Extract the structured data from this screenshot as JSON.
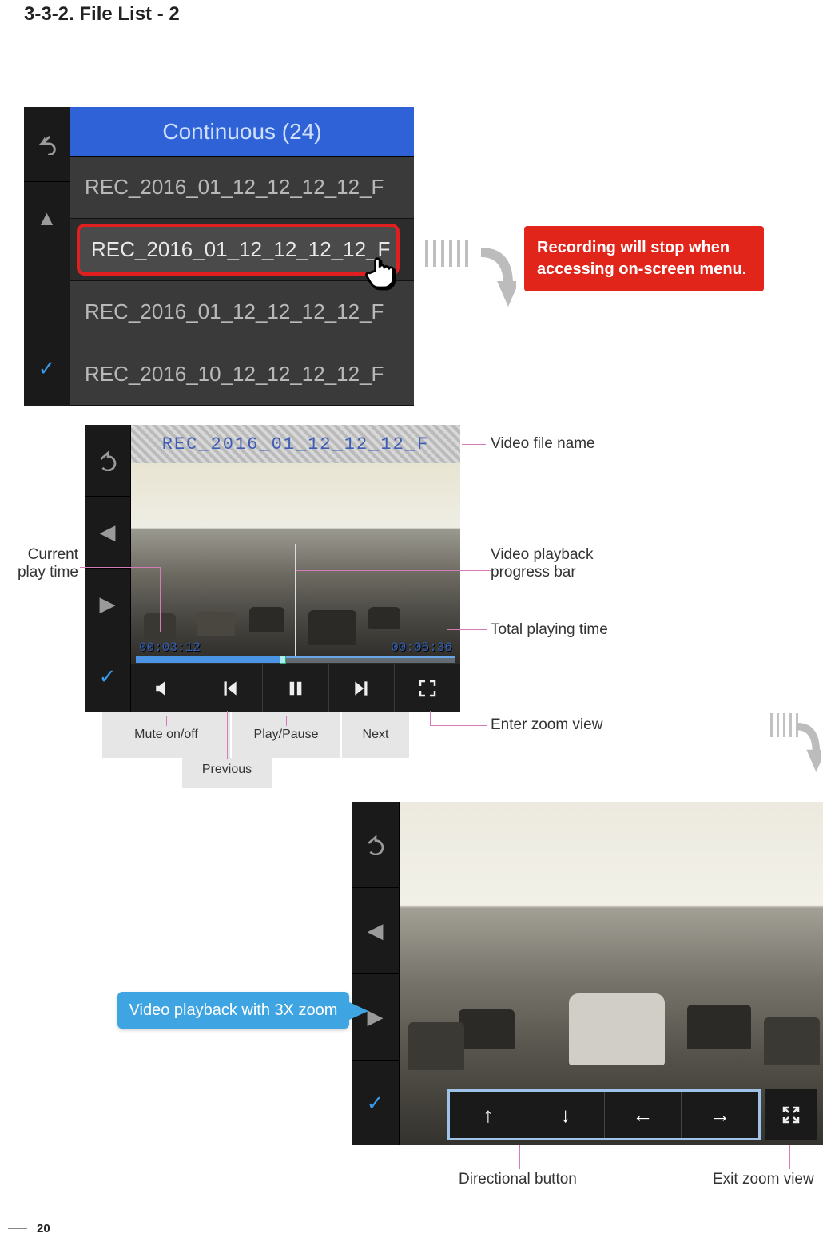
{
  "section_title": "3-3-2. File List - 2",
  "page_number": "20",
  "warning_text": "Recording will stop when accessing on-screen menu.",
  "filelist": {
    "header": "Continuous (24)",
    "rows": [
      "REC_2016_01_12_12_12_12_F",
      "REC_2016_01_12_12_12_12_F",
      "REC_2016_01_12_12_12_12_F",
      "REC_2016_10_12_12_12_12_F"
    ],
    "selected_index": 1
  },
  "playback": {
    "filename": "REC_2016_01_12_12_12_F",
    "current_time": "00:03:12",
    "total_time": "00:05:36",
    "progress_pct": 45,
    "annotations": {
      "filename": "Video file name",
      "current_time": "Current play time",
      "progress_bar": "Video playback progress bar",
      "total_time": "Total playing time",
      "mute": "Mute on/off",
      "previous": "Previous",
      "play_pause": "Play/Pause",
      "next": "Next",
      "zoom_enter": "Enter zoom view"
    },
    "controls": {
      "mute_icon": "speaker-icon",
      "prev_icon": "previous-icon",
      "play_icon": "pause-icon",
      "next_icon": "next-icon",
      "zoom_icon": "expand-icon"
    }
  },
  "zoom": {
    "callout": "Video playback with 3X zoom",
    "annotations": {
      "directional": "Directional button",
      "exit": "Exit zoom view"
    },
    "directions": [
      "up",
      "down",
      "left",
      "right"
    ]
  },
  "icons": {
    "back": "↶",
    "up": "▲",
    "down": "▼",
    "check": "✓",
    "left_tri": "◀",
    "right_tri": "▶",
    "speaker": "🔈",
    "prev": "⏮",
    "pause": "❚❚",
    "next": "⏭",
    "expand": "⛶",
    "arrow_up": "↑",
    "arrow_down": "↓",
    "arrow_left": "←",
    "arrow_right": "→",
    "collapse": "✕"
  }
}
